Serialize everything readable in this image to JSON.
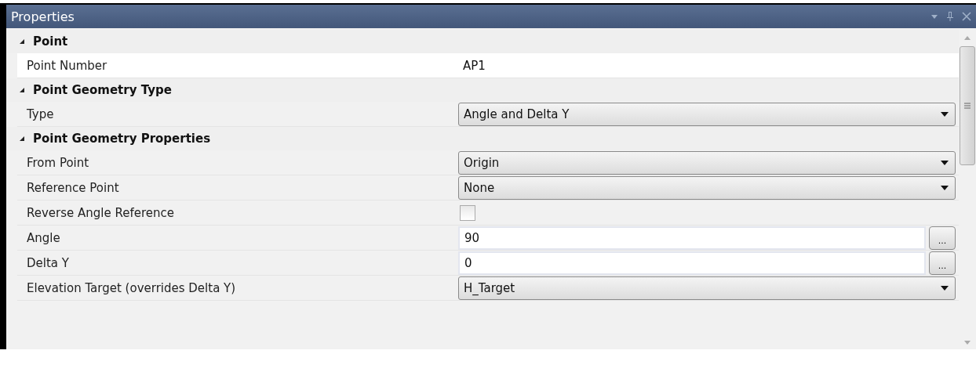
{
  "window": {
    "title": "Properties"
  },
  "categories": [
    {
      "name": "Point",
      "expanded": true,
      "properties": [
        {
          "label": "Point Number",
          "kind": "text",
          "value": "AP1",
          "selected": true
        }
      ]
    },
    {
      "name": "Point Geometry Type",
      "expanded": true,
      "properties": [
        {
          "label": "Type",
          "kind": "dropdown",
          "value": "Angle and Delta Y",
          "selected": false
        }
      ]
    },
    {
      "name": "Point Geometry Properties",
      "expanded": true,
      "properties": [
        {
          "label": "From Point",
          "kind": "dropdown",
          "value": "Origin",
          "selected": false
        },
        {
          "label": "Reference Point",
          "kind": "dropdown",
          "value": "None",
          "selected": false
        },
        {
          "label": "Reverse Angle Reference",
          "kind": "checkbox",
          "checked": false,
          "selected": false
        },
        {
          "label": "Angle",
          "kind": "text_button",
          "value": "90",
          "button": "...",
          "selected": false
        },
        {
          "label": "Delta Y",
          "kind": "text_button",
          "value": "0",
          "button": "...",
          "selected": false
        },
        {
          "label": "Elevation Target (overrides Delta Y)",
          "kind": "dropdown",
          "value": "H_Target",
          "selected": false
        }
      ]
    }
  ]
}
